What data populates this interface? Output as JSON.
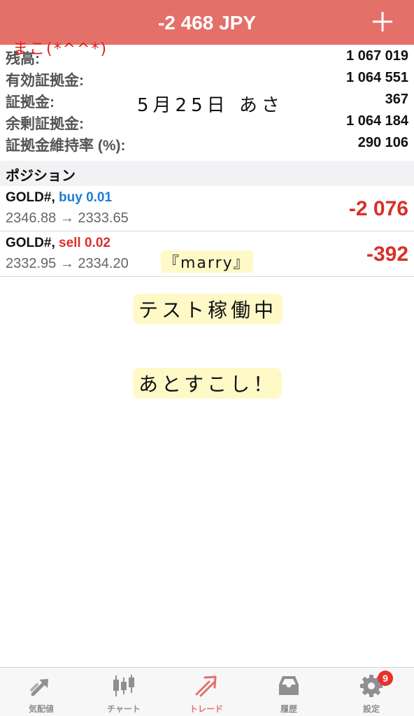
{
  "header": {
    "title": "-2 468 JPY",
    "add_icon": "plus-icon"
  },
  "summary": [
    {
      "label": "残高:",
      "value": "1 067 019"
    },
    {
      "label": "有効証拠金:",
      "value": "1 064 551"
    },
    {
      "label": "証拠金:",
      "value": "367"
    },
    {
      "label": "余剰証拠金:",
      "value": "1 064 184"
    },
    {
      "label": "証拠金維持率 (%):",
      "value": "290 106"
    }
  ],
  "positions_section": {
    "title": "ポジション"
  },
  "positions": [
    {
      "symbol": "GOLD#,",
      "side": "buy 0.01",
      "prices": "2346.88 → 2333.65",
      "profit": "-2 076"
    },
    {
      "symbol": "GOLD#,",
      "side": "sell 0.02",
      "prices": "2332.95 → 2334.20",
      "profit": "-392"
    }
  ],
  "handwritten": {
    "name": "まこ(*^^*)",
    "date": "5月25日 あさ",
    "tag": "『marry』",
    "note1": "テスト稼働中",
    "note2": "あとすこし！"
  },
  "tabs": [
    {
      "label": "気配値",
      "icon": "quotes-icon",
      "active": false
    },
    {
      "label": "チャート",
      "icon": "chart-icon",
      "active": false
    },
    {
      "label": "トレード",
      "icon": "trade-icon",
      "active": true
    },
    {
      "label": "履歴",
      "icon": "history-icon",
      "active": false
    },
    {
      "label": "設定",
      "icon": "settings-icon",
      "active": false,
      "badge": "9"
    }
  ],
  "colors": {
    "header_bg": "#e4706a",
    "loss_red": "#d8302a",
    "buy_blue": "#1e7bd6",
    "active_tab": "#e4706a",
    "inactive_tab": "#8e8e93"
  }
}
